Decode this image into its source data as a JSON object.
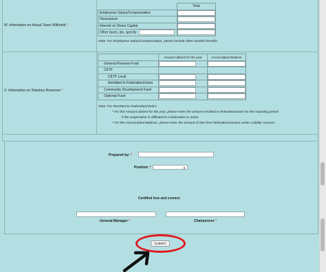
{
  "section_w": {
    "label": "W. Information on Actual Taxes Withheld",
    "required_mark": "*",
    "column_header": "Total",
    "rows": [
      {
        "label": "Employees Salary/Compensation",
        "value": ""
      },
      {
        "label": "Honorarium",
        "value": ""
      },
      {
        "label": "Interest on Share Capital",
        "value": ""
      },
      {
        "label": "Other taxes, pls. specify",
        "value": ""
      }
    ],
    "note": "Note: For Employees Salary/Compensation, please include other taxable benefits."
  },
  "section_x": {
    "label": "X. Information on Statutory Reserves",
    "required_mark": "*",
    "headers": [
      "Amount utilized for the year",
      "Accumulated Balance"
    ],
    "rows": [
      {
        "label": "General Reserve Fund",
        "has_inputs": true
      },
      {
        "label": "CETF",
        "has_inputs": false
      },
      {
        "label": "CETF Local",
        "has_inputs": true
      },
      {
        "label": "Remitted to Federation/Union",
        "has_inputs": true
      },
      {
        "label": "Community Development Fund",
        "has_inputs": true
      },
      {
        "label": "Optional Fund",
        "has_inputs": true
      }
    ],
    "note_title": "Note: For Remitted to Federation/Union:",
    "note_line1": "* For the Amount utilized for the year, please enter the amount remitted to federation/union for the reporting period",
    "note_line2": "if the cooperative is affiliated to a federation or union.",
    "note_line3": "* For the Accumulated Balance, please enter the amount of due from federations/unions under Liability Account."
  },
  "signatures": {
    "prepared_by_label": "Prepared by:",
    "position_label": "Position:",
    "position_value": "",
    "certified_label": "Certified true and correct:",
    "general_manager_label": "General Manager",
    "chairperson_label": "Chairperson",
    "required_mark": "*"
  },
  "submit_label": "SUBMIT",
  "colors": {
    "background": "#b3dfe2",
    "highlight": "#e0191f"
  }
}
